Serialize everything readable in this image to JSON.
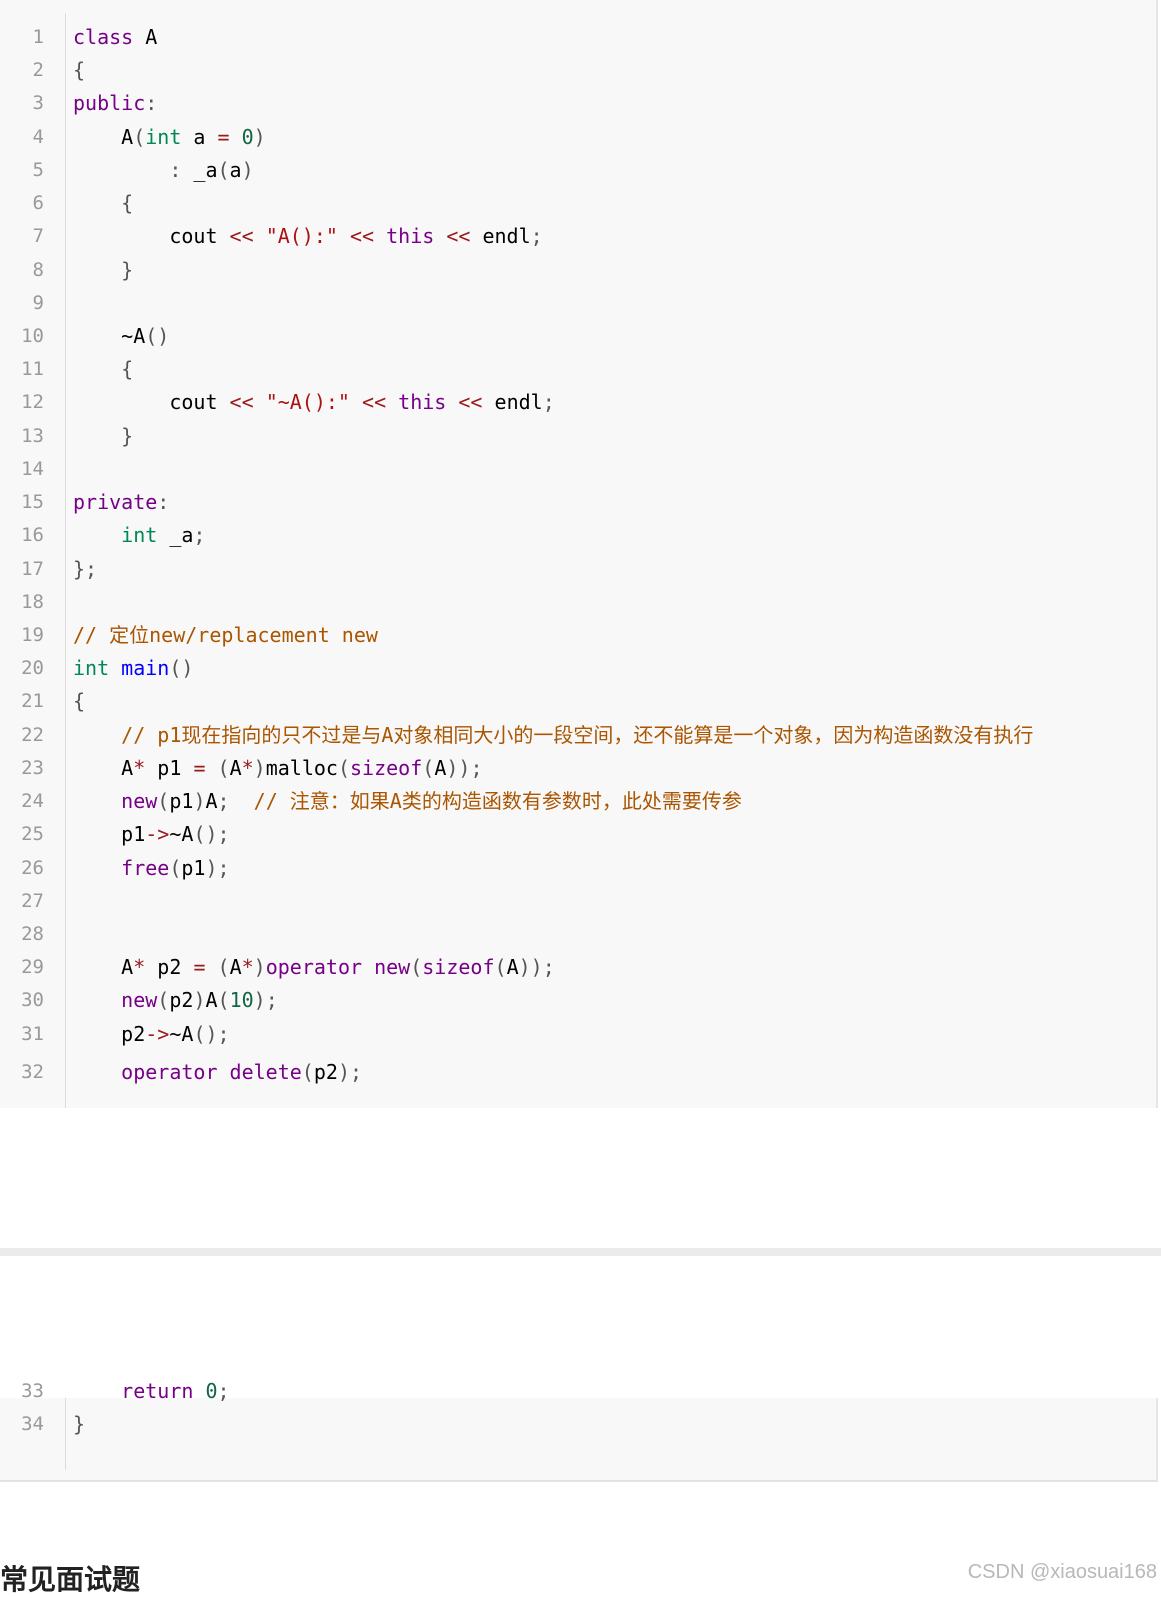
{
  "block1_lines": [
    {
      "n": "1",
      "code": "class A"
    },
    {
      "n": "2",
      "code": "{"
    },
    {
      "n": "3",
      "code": "public:"
    },
    {
      "n": "4",
      "code": "    A(int a = 0)"
    },
    {
      "n": "5",
      "code": "        : _a(a)"
    },
    {
      "n": "6",
      "code": "    {"
    },
    {
      "n": "7",
      "code": "        cout << \"A():\" << this << endl;"
    },
    {
      "n": "8",
      "code": "    }"
    },
    {
      "n": "9",
      "code": ""
    },
    {
      "n": "10",
      "code": "    ~A()"
    },
    {
      "n": "11",
      "code": "    {"
    },
    {
      "n": "12",
      "code": "        cout << \"~A():\" << this << endl;"
    },
    {
      "n": "13",
      "code": "    }"
    },
    {
      "n": "14",
      "code": ""
    },
    {
      "n": "15",
      "code": "private:"
    },
    {
      "n": "16",
      "code": "    int _a;"
    },
    {
      "n": "17",
      "code": "};"
    },
    {
      "n": "18",
      "code": ""
    },
    {
      "n": "19",
      "code": "// 定位new/replacement new"
    },
    {
      "n": "20",
      "code": "int main()"
    },
    {
      "n": "21",
      "code": "{"
    },
    {
      "n": "22",
      "code": "    // p1现在指向的只不过是与A对象相同大小的一段空间，还不能算是一个对象，因为构造函数没有执行"
    },
    {
      "n": "23",
      "code": "    A* p1 = (A*)malloc(sizeof(A));"
    },
    {
      "n": "24",
      "code": "    new(p1)A;  // 注意：如果A类的构造函数有参数时，此处需要传参"
    },
    {
      "n": "25",
      "code": "    p1->~A();"
    },
    {
      "n": "26",
      "code": "    free(p1);"
    },
    {
      "n": "27",
      "code": ""
    },
    {
      "n": "28",
      "code": ""
    },
    {
      "n": "29",
      "code": "    A* p2 = (A*)operator new(sizeof(A));"
    },
    {
      "n": "30",
      "code": "    new(p2)A(10);"
    },
    {
      "n": "31",
      "code": "    p2->~A();"
    },
    {
      "n": "32",
      "code": "    operator delete(p2);"
    }
  ],
  "block2_lines": [
    {
      "n": "33",
      "code": "    return 0;"
    },
    {
      "n": "34",
      "code": "}"
    }
  ],
  "heading": "常见面试题",
  "watermark": "CSDN @xiaosuai168"
}
